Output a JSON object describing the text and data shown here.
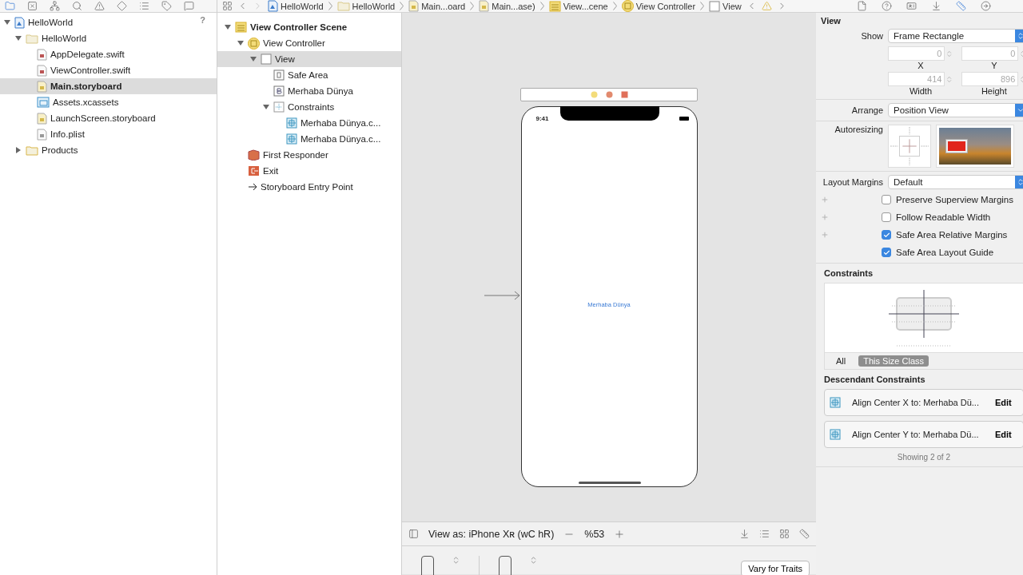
{
  "navigator": {
    "badge": "?",
    "tree": [
      {
        "label": "HelloWorld",
        "kind": "project",
        "expanded": true,
        "selected": false,
        "children": [
          {
            "label": "HelloWorld",
            "kind": "folder",
            "expanded": true,
            "selected": false,
            "children": [
              {
                "label": "AppDelegate.swift",
                "kind": "swift",
                "selected": false
              },
              {
                "label": "ViewController.swift",
                "kind": "swift",
                "selected": false
              },
              {
                "label": "Main.storyboard",
                "kind": "storyboard",
                "selected": true
              },
              {
                "label": "Assets.xcassets",
                "kind": "assets",
                "selected": false
              },
              {
                "label": "LaunchScreen.storyboard",
                "kind": "storyboard",
                "selected": false
              },
              {
                "label": "Info.plist",
                "kind": "plist",
                "selected": false
              }
            ]
          },
          {
            "label": "Products",
            "kind": "products",
            "expanded": false,
            "selected": false
          }
        ]
      }
    ]
  },
  "breadcrumbs": [
    {
      "label": "HelloWorld",
      "kind": "project"
    },
    {
      "label": "HelloWorld",
      "kind": "folder"
    },
    {
      "label": "Main...oard",
      "kind": "storyboard"
    },
    {
      "label": "Main...ase)",
      "kind": "storyboard"
    },
    {
      "label": "View...cene",
      "kind": "scene"
    },
    {
      "label": "View Controller",
      "kind": "controller"
    },
    {
      "label": "View",
      "kind": "view"
    }
  ],
  "outline": [
    {
      "label": "View Controller Scene",
      "kind": "scene",
      "expanded": true,
      "selected": false,
      "children": [
        {
          "label": "View Controller",
          "kind": "controller",
          "expanded": true,
          "selected": false,
          "children": [
            {
              "label": "View",
              "kind": "view",
              "expanded": true,
              "selected": true,
              "children": [
                {
                  "label": "Safe Area",
                  "kind": "safearea",
                  "selected": false
                },
                {
                  "label": "Merhaba Dünya",
                  "kind": "label",
                  "selected": false
                },
                {
                  "label": "Constraints",
                  "kind": "constraints",
                  "expanded": true,
                  "selected": false,
                  "children": [
                    {
                      "label": "Merhaba Dünya.c...",
                      "kind": "constraint",
                      "selected": false
                    },
                    {
                      "label": "Merhaba Dünya.c...",
                      "kind": "constraint",
                      "selected": false
                    }
                  ]
                }
              ]
            }
          ]
        },
        {
          "label": "First Responder",
          "kind": "responder",
          "selected": false
        },
        {
          "label": "Exit",
          "kind": "exit",
          "selected": false
        },
        {
          "label": "Storyboard Entry Point",
          "kind": "entry",
          "selected": false
        }
      ]
    }
  ],
  "canvas": {
    "status_time": "9:41",
    "label": "Merhaba Dünya",
    "view_as": "View as: iPhone Xʀ (wC hR)",
    "zoom": "%53",
    "vary_button": "Vary for Traits"
  },
  "inspector": {
    "title": "View",
    "show": {
      "label": "Show",
      "value": "Frame Rectangle"
    },
    "frame": [
      {
        "value": "0",
        "label": "X",
        "disabled": true
      },
      {
        "value": "0",
        "label": "Y",
        "disabled": true
      },
      {
        "value": "414",
        "label": "Width",
        "disabled": true
      },
      {
        "value": "896",
        "label": "Height",
        "disabled": true
      }
    ],
    "arrange": {
      "label": "Arrange",
      "value": "Position View"
    },
    "autoresizing": {
      "label": "Autoresizing"
    },
    "layout_margins": {
      "label": "Layout Margins",
      "value": "Default"
    },
    "options": [
      {
        "label": "Preserve Superview Margins",
        "checked": false,
        "plus": true
      },
      {
        "label": "Follow Readable Width",
        "checked": false,
        "plus": true
      },
      {
        "label": "Safe Area Relative Margins",
        "checked": true,
        "plus": true
      },
      {
        "label": "Safe Area Layout Guide",
        "checked": true,
        "plus": false
      }
    ],
    "constraints": {
      "title": "Constraints",
      "tabs": [
        {
          "label": "All",
          "selected": false
        },
        {
          "label": "This Size Class",
          "selected": true
        }
      ]
    },
    "descendant": {
      "title": "Descendant Constraints",
      "items": [
        {
          "text": "Align Center X to:  Merhaba Dü...",
          "action": "Edit"
        },
        {
          "text": "Align Center Y to:  Merhaba Dü...",
          "action": "Edit"
        }
      ],
      "footer": "Showing 2 of 2"
    }
  }
}
